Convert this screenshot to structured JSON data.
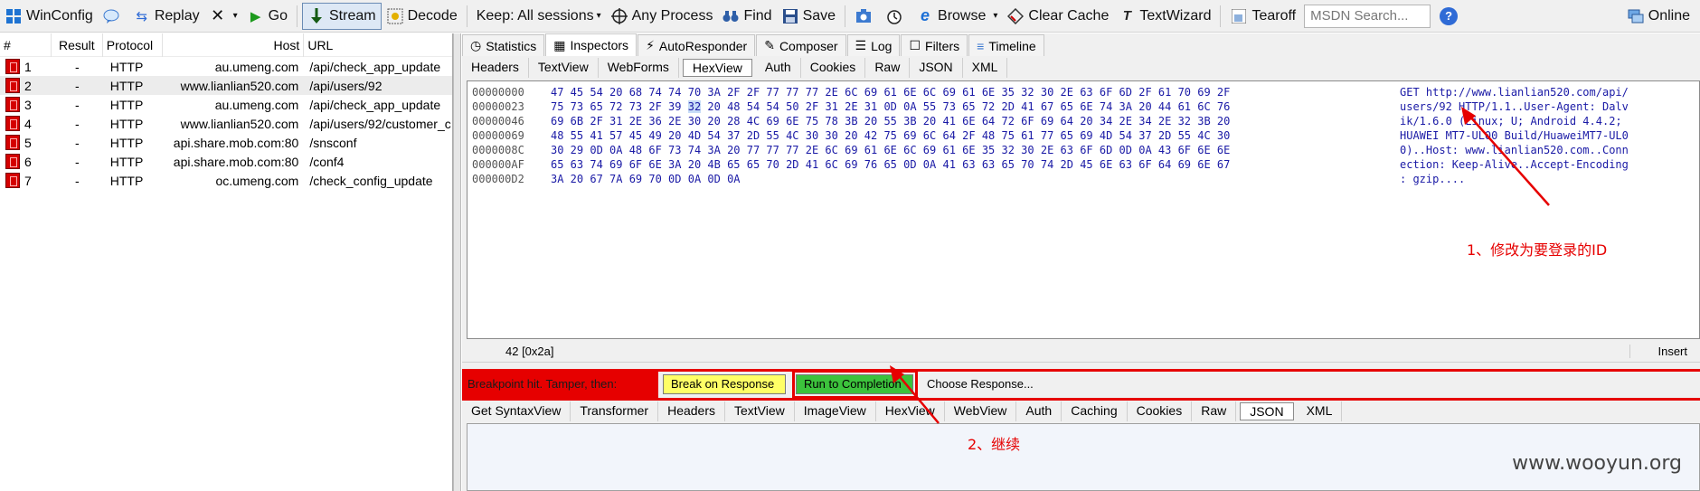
{
  "toolbar": {
    "items": [
      {
        "label": "WinConfig",
        "icon": "windows-icon"
      },
      {
        "label": "Replay",
        "icon": "speech-bubble-icon"
      },
      {
        "label": "",
        "icon": "replay-arrows-icon"
      },
      {
        "label": "Go",
        "icon": "play-icon"
      },
      {
        "label": "Stream",
        "icon": "stream-icon"
      },
      {
        "label": "Decode",
        "icon": "decode-icon"
      },
      {
        "label": "Keep: All sessions",
        "icon": "dropdown-icon"
      },
      {
        "label": "Any Process",
        "icon": "crosshair-icon"
      },
      {
        "label": "Find",
        "icon": "binoculars-icon"
      },
      {
        "label": "Save",
        "icon": "save-icon"
      },
      {
        "label": "",
        "icon": "camera-icon"
      },
      {
        "label": "",
        "icon": "timer-icon"
      },
      {
        "label": "Browse",
        "icon": "ie-icon"
      },
      {
        "label": "Clear Cache",
        "icon": "clear-cache-icon"
      },
      {
        "label": "TextWizard",
        "icon": "textwizard-icon"
      },
      {
        "label": "Tearoff",
        "icon": "tearoff-icon"
      }
    ],
    "search_placeholder": "MSDN Search...",
    "online_label": "Online"
  },
  "sessions": {
    "columns": [
      "#",
      "Result",
      "Protocol",
      "Host",
      "URL"
    ],
    "rows": [
      {
        "num": "1",
        "result": "-",
        "protocol": "HTTP",
        "host": "au.umeng.com",
        "url": "/api/check_app_update"
      },
      {
        "num": "2",
        "result": "-",
        "protocol": "HTTP",
        "host": "www.lianlian520.com",
        "url": "/api/users/92"
      },
      {
        "num": "3",
        "result": "-",
        "protocol": "HTTP",
        "host": "au.umeng.com",
        "url": "/api/check_app_update"
      },
      {
        "num": "4",
        "result": "-",
        "protocol": "HTTP",
        "host": "www.lianlian520.com",
        "url": "/api/users/92/customer_c"
      },
      {
        "num": "5",
        "result": "-",
        "protocol": "HTTP",
        "host": "api.share.mob.com:80",
        "url": "/snsconf"
      },
      {
        "num": "6",
        "result": "-",
        "protocol": "HTTP",
        "host": "api.share.mob.com:80",
        "url": "/conf4"
      },
      {
        "num": "7",
        "result": "-",
        "protocol": "HTTP",
        "host": "oc.umeng.com",
        "url": "/check_config_update"
      }
    ]
  },
  "main_tabs": [
    {
      "label": "Statistics",
      "icon": "stopwatch-icon"
    },
    {
      "label": "Inspectors",
      "icon": "inspectors-icon"
    },
    {
      "label": "AutoResponder",
      "icon": "lightning-icon"
    },
    {
      "label": "Composer",
      "icon": "composer-icon"
    },
    {
      "label": "Log",
      "icon": "log-icon"
    },
    {
      "label": "Filters",
      "icon": "checkbox-icon"
    },
    {
      "label": "Timeline",
      "icon": "timeline-icon"
    }
  ],
  "request_tabs": [
    "Headers",
    "TextView",
    "WebForms",
    "HexView",
    "Auth",
    "Cookies",
    "Raw",
    "JSON",
    "XML"
  ],
  "hex": {
    "rows": [
      {
        "offset": "00000000",
        "bytes": "47 45 54 20 68 74 74 70 3A 2F 2F 77 77 77 2E 6C 69 61 6E 6C 69 61 6E 35 32 30 2E 63 6F 6D 2F 61 70 69 2F",
        "text": "GET http://www.lianlian520.com/api/"
      },
      {
        "offset": "00000023",
        "bytes": "75 73 65 72 73 2F 39 32 20 48 54 54 50 2F 31 2E 31 0D 0A 55 73 65 72 2D 41 67 65 6E 74 3A 20 44 61 6C 76",
        "text": "users/92 HTTP/1.1..User-Agent: Dalv"
      },
      {
        "offset": "00000046",
        "bytes": "69 6B 2F 31 2E 36 2E 30 20 28 4C 69 6E 75 78 3B 20 55 3B 20 41 6E 64 72 6F 69 64 20 34 2E 34 2E 32 3B 20",
        "text": "ik/1.6.0 (Linux; U; Android 4.4.2;"
      },
      {
        "offset": "00000069",
        "bytes": "48 55 41 57 45 49 20 4D 54 37 2D 55 4C 30 30 20 42 75 69 6C 64 2F 48 75 61 77 65 69 4D 54 37 2D 55 4C 30",
        "text": "HUAWEI MT7-UL00 Build/HuaweiMT7-UL0"
      },
      {
        "offset": "0000008C",
        "bytes": "30 29 0D 0A 48 6F 73 74 3A 20 77 77 77 2E 6C 69 61 6E 6C 69 61 6E 35 32 30 2E 63 6F 6D 0D 0A 43 6F 6E 6E",
        "text": "0)..Host: www.lianlian520.com..Conn"
      },
      {
        "offset": "000000AF",
        "bytes": "65 63 74 69 6F 6E 3A 20 4B 65 65 70 2D 41 6C 69 76 65 0D 0A 41 63 63 65 70 74 2D 45 6E 63 6F 64 69 6E 67",
        "text": "ection: Keep-Alive..Accept-Encoding"
      },
      {
        "offset": "000000D2",
        "bytes": "3A 20 67 7A 69 70 0D 0A 0D 0A",
        "text": ": gzip...."
      }
    ],
    "position": "42 [0x2a]",
    "mode": "Insert"
  },
  "breakpoint": {
    "message": "Breakpoint hit. Tamper, then:",
    "break_on_response": "Break on Response",
    "run_to_completion": "Run to Completion",
    "choose_response": "Choose Response..."
  },
  "response_tabs": [
    "Get SyntaxView",
    "Transformer",
    "Headers",
    "TextView",
    "ImageView",
    "HexView",
    "WebView",
    "Auth",
    "Caching",
    "Cookies",
    "Raw",
    "JSON",
    "XML"
  ],
  "annotations": {
    "step1": "1、修改为要登录的ID",
    "step2": "2、继续"
  },
  "watermark": "www.wooyun.org",
  "colors": {
    "breakpoint_red": "#e60000",
    "break_on_response_yellow": "#ffff66",
    "run_to_completion_green": "#3cc23c",
    "hex_text_blue": "#1a1aa6"
  }
}
